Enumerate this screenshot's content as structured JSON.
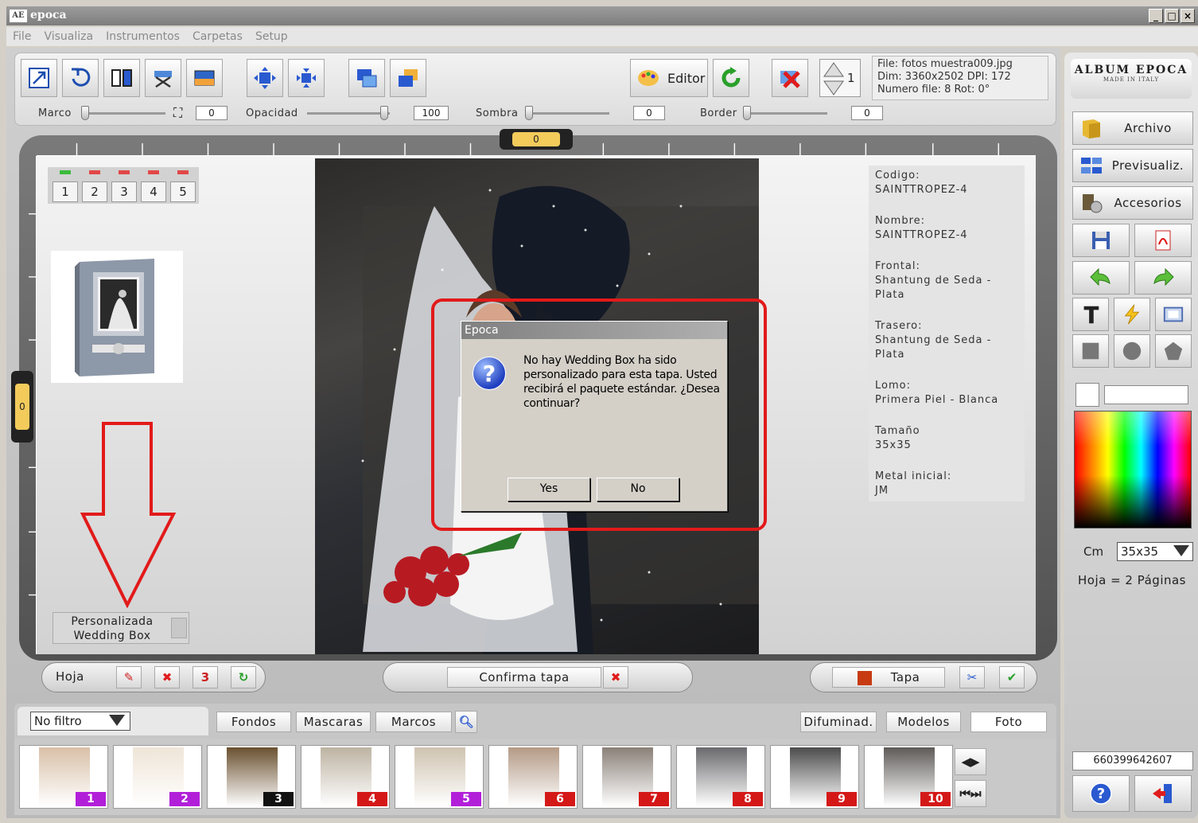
{
  "window": {
    "app_icon_text": "AE",
    "title": "epoca"
  },
  "menu": [
    "File",
    "Visualiza",
    "Instrumentos",
    "Carpetas",
    "Setup"
  ],
  "toolbar": {
    "editor_label": "Editor",
    "counter_value": "1",
    "file_info": {
      "line1": "File: fotos muestra009.jpg",
      "line2": "Dim: 3360x2502 DPI: 172",
      "line3": "Numero file: 8 Rot: 0°"
    },
    "sliders": [
      {
        "label": "Marco",
        "value": "0"
      },
      {
        "label": "Opacidad",
        "value": "100"
      },
      {
        "label": "Sombra",
        "value": "0"
      },
      {
        "label": "Border",
        "value": "0"
      }
    ]
  },
  "canvas": {
    "ruler_top_value": "0",
    "ruler_left_value": "0",
    "page_tabs": [
      {
        "label": "1",
        "mark_color": "#3cba3c"
      },
      {
        "label": "2",
        "mark_color": "#e24848"
      },
      {
        "label": "3",
        "mark_color": "#e24848"
      },
      {
        "label": "4",
        "mark_color": "#e24848"
      },
      {
        "label": "5",
        "mark_color": "#e24848"
      }
    ],
    "personalizada_line1": "Personalizada",
    "personalizada_line2": "Wedding Box"
  },
  "info": [
    {
      "label": "Codigo:",
      "value": "SAINTTROPEZ-4"
    },
    {
      "label": "Nombre:",
      "value": "SAINTTROPEZ-4"
    },
    {
      "label": "Frontal:",
      "value": "Shantung de Seda - Plata"
    },
    {
      "label": "Trasero:",
      "value": "Shantung de Seda - Plata"
    },
    {
      "label": "Lomo:",
      "value": "Primera Piel - Blanca"
    },
    {
      "label": "Tamaño",
      "value": "35x35"
    },
    {
      "label": "Metal inicial:",
      "value": "JM"
    }
  ],
  "dialog": {
    "title": "Epoca",
    "message": "No hay Wedding Box ha sido personalizado para esta tapa. Usted recibirá el paquete estándar. ¿Desea continuar?",
    "yes_label": "Yes",
    "no_label": "No",
    "highlight_color": "#e21a1a"
  },
  "bottombar": {
    "hoja_label": "Hoja",
    "hoja_count_badge": "3",
    "confirma_label": "Confirma tapa",
    "tapa_label": "Tapa"
  },
  "filters": {
    "selected": "No filtro",
    "tabs_left": [
      "Fondos",
      "Mascaras",
      "Marcos"
    ],
    "tabs_right": [
      "Difuminad.",
      "Modelos",
      "Foto"
    ]
  },
  "thumbnails": [
    {
      "num": "1",
      "badge_color": "#b21fd9"
    },
    {
      "num": "2",
      "badge_color": "#b21fd9"
    },
    {
      "num": "3",
      "badge_color": "#111111"
    },
    {
      "num": "4",
      "badge_color": "#d41818"
    },
    {
      "num": "5",
      "badge_color": "#b21fd9"
    },
    {
      "num": "6",
      "badge_color": "#d41818"
    },
    {
      "num": "7",
      "badge_color": "#d41818"
    },
    {
      "num": "8",
      "badge_color": "#d41818"
    },
    {
      "num": "9",
      "badge_color": "#d41818"
    },
    {
      "num": "10",
      "badge_color": "#d41818"
    }
  ],
  "right": {
    "logo_line1": "ALBUM EPOCA",
    "logo_line2": "MADE IN ITALY",
    "archivo_label": "Archivo",
    "previsualiz_label": "Previsualiz.",
    "accesorios_label": "Accesorios",
    "cm_label": "Cm",
    "size_value": "35x35",
    "hoja_info": "Hoja = 2 Páginas",
    "serial": "660399642607"
  }
}
